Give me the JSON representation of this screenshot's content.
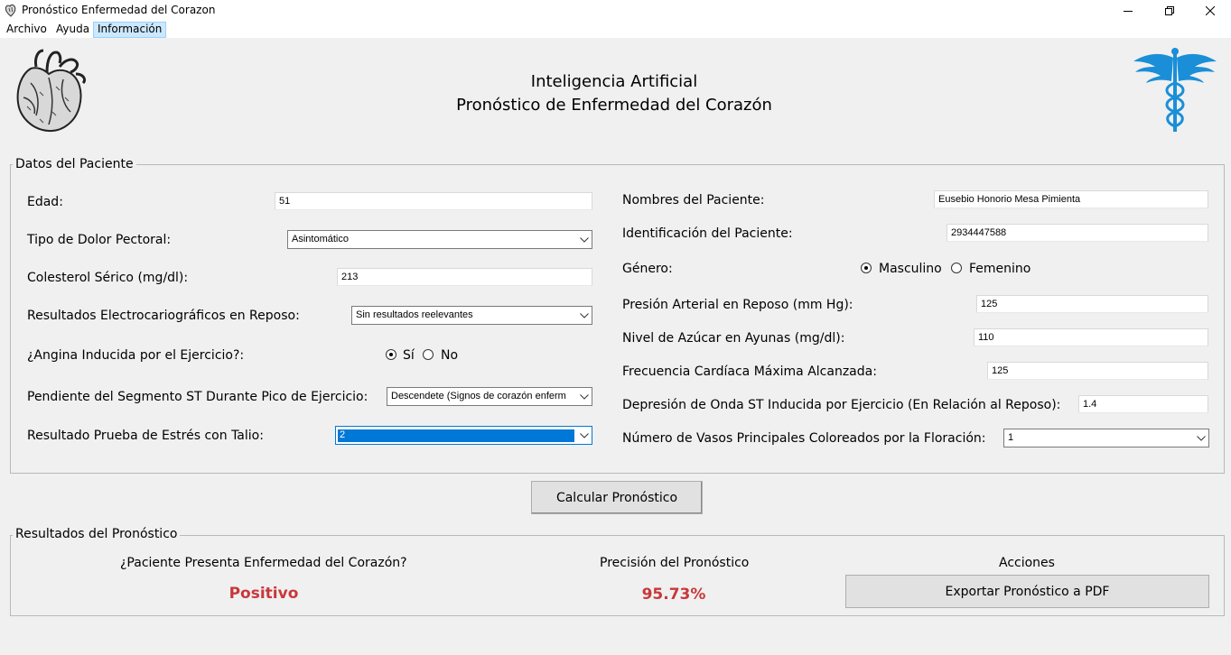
{
  "window": {
    "title": "Pronóstico Enfermedad del Corazon"
  },
  "menu": {
    "items": [
      "Archivo",
      "Ayuda",
      "Información"
    ],
    "active": "Información"
  },
  "header": {
    "line1": "Inteligencia Artificial",
    "line2": "Pronóstico de Enfermedad del Corazón"
  },
  "patient_group": {
    "legend": "Datos del Paciente",
    "left": {
      "age_label": "Edad:",
      "age_value": "51",
      "chest_pain_label": "Tipo de Dolor Pectoral:",
      "chest_pain_value": "Asintomático",
      "cholesterol_label": "Colesterol Sérico (mg/dl):",
      "cholesterol_value": "213",
      "ecg_label": "Resultados Electrocariográficos en Reposo:",
      "ecg_value": "Sin resultados reelevantes",
      "angina_label": "¿Angina Inducida por el Ejercicio?:",
      "angina_yes": "Sí",
      "angina_no": "No",
      "angina_selected": "Sí",
      "slope_label": "Pendiente del Segmento ST Durante Pico de Ejercicio:",
      "slope_value": "Descendete (Signos de corazón enferm",
      "thal_label": "Resultado Prueba de Estrés con Talio:",
      "thal_value": "2"
    },
    "right": {
      "name_label": "Nombres del Paciente:",
      "name_value": "Eusebio Honorio Mesa Pimienta",
      "id_label": "Identificación del Paciente:",
      "id_value": "2934447588",
      "gender_label": "Género:",
      "gender_male": "Masculino",
      "gender_female": "Femenino",
      "gender_selected": "Masculino",
      "bp_label": "Presión Arterial en Reposo (mm Hg):",
      "bp_value": "125",
      "sugar_label": "Nivel de Azúcar en Ayunas (mg/dl):",
      "sugar_value": "110",
      "hr_label": "Frecuencia Cardíaca Máxima Alcanzada:",
      "hr_value": "125",
      "oldpeak_label": "Depresión de Onda ST Inducida por Ejercicio (En Relación al Reposo):",
      "oldpeak_value": "1.4",
      "vessels_label": "Número de Vasos Principales Coloreados por la Floración:",
      "vessels_value": "1"
    }
  },
  "calc_button": "Calcular Pronóstico",
  "results_group": {
    "legend": "Resultados del Pronóstico",
    "question_label": "¿Paciente Presenta Enfermedad del Corazón?",
    "question_value": "Positivo",
    "precision_label": "Precisión del Pronóstico",
    "precision_value": "95.73%",
    "actions_label": "Acciones",
    "export_button": "Exportar Pronóstico a PDF"
  },
  "colors": {
    "result_red": "#c9373b",
    "caduceus_blue": "#1a8fd8",
    "selection_blue": "#0078d7"
  }
}
